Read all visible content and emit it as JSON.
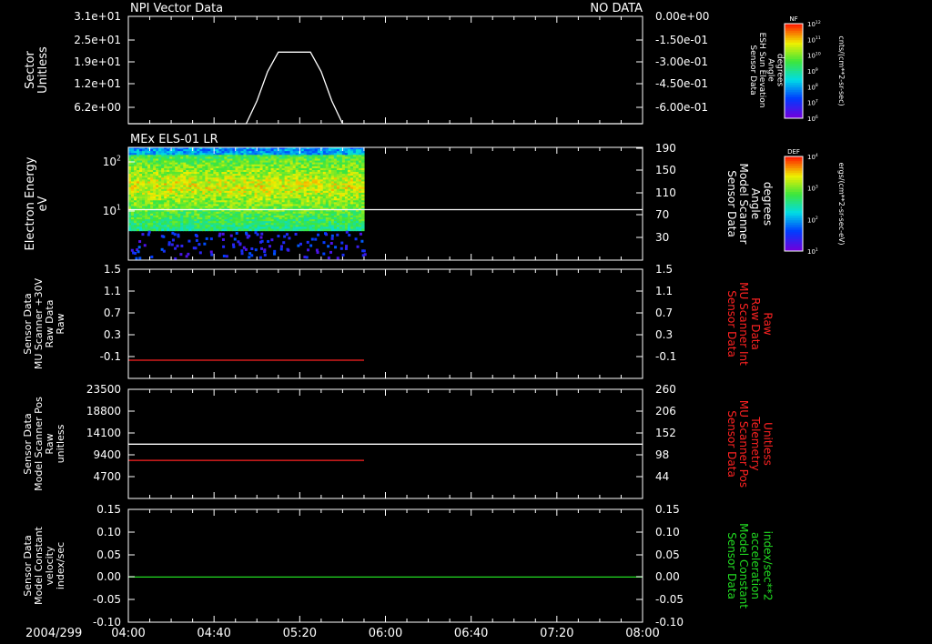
{
  "date_label": "2004/299",
  "time_axis": {
    "range": [
      "04:00",
      "08:00"
    ],
    "ticks": [
      "04:00",
      "04:40",
      "05:20",
      "06:00",
      "06:40",
      "07:20",
      "08:00"
    ]
  },
  "chart_data": [
    {
      "type": "line",
      "title": "NPI Vector Data",
      "status": "NO DATA",
      "ylabel": [
        "Sector",
        "Unitless"
      ],
      "y_ticks": [
        "3.1e+01",
        "2.5e+01",
        "1.9e+01",
        "1.2e+01",
        "6.2e+00"
      ],
      "ylim": [
        0,
        33
      ],
      "right_ylabel": [
        "Sensor Data",
        "ESH Sun Elevation",
        "Angle",
        "degrees"
      ],
      "right_ticks": [
        "0.00e+00",
        "-1.50e-01",
        "-3.00e-01",
        "-4.50e-01",
        "-6.00e-01"
      ],
      "series": [
        {
          "color": "#ffffff",
          "x": [
            "04:00",
            "04:55",
            "05:00",
            "05:05",
            "05:10",
            "05:25",
            "05:30",
            "05:35",
            "05:40",
            "08:00"
          ],
          "y": [
            0,
            0,
            7,
            16,
            22,
            22,
            16,
            7,
            0,
            0
          ]
        }
      ],
      "colorbar": {
        "label": "NF",
        "units": "cnts/(cm**2-sr-sec)",
        "ticks": [
          "10^12",
          "10^11",
          "10^10",
          "10^9",
          "10^8",
          "10^7",
          "10^6"
        ]
      }
    },
    {
      "type": "heatmap",
      "title": "MEx ELS-01 LR",
      "ylabel": [
        "Electron Energy",
        "eV"
      ],
      "y_ticks": [
        "10^2",
        "10^1"
      ],
      "yscale": "log",
      "ylim": [
        1,
        200
      ],
      "right_ylabel": [
        "Sensor Data",
        "Model Scanner",
        "Angle",
        "degrees"
      ],
      "right_ticks": [
        "190",
        "150",
        "110",
        "70",
        "30"
      ],
      "data_extent": [
        "04:00",
        "05:50"
      ],
      "energy_extent": [
        2,
        200
      ],
      "series": [
        {
          "color": "#ffffff",
          "x": [
            "04:00",
            "08:00"
          ],
          "y": [
            90,
            90
          ]
        }
      ],
      "colorbar": {
        "label": "DEF",
        "units": "ergs/(cm**2-sr-sec-eV)",
        "ticks": [
          "10^4",
          "10^3",
          "10^2",
          "10^1"
        ]
      }
    },
    {
      "type": "line",
      "ylabel": [
        "Sensor Data",
        "MU Scanner +30V",
        "Raw Data",
        "Raw"
      ],
      "y_ticks": [
        "1.5",
        "1.1",
        "0.7",
        "0.3",
        "-0.1"
      ],
      "ylim": [
        -0.3,
        1.5
      ],
      "right_ylabel": [
        "Sensor Data",
        "MU Scanner Int",
        "Raw Data",
        "Raw"
      ],
      "right_ticks": [
        "1.5",
        "1.1",
        "0.7",
        "0.3",
        "-0.1"
      ],
      "series": [
        {
          "color": "#ff2222",
          "x": [
            "04:00",
            "05:50"
          ],
          "y": [
            0,
            0
          ]
        }
      ]
    },
    {
      "type": "line",
      "ylabel": [
        "Sensor Data",
        "Model Scanner Pos",
        "Raw",
        "unitless"
      ],
      "y_ticks": [
        "23500",
        "18800",
        "14100",
        "9400",
        "4700"
      ],
      "ylim": [
        0,
        23500
      ],
      "right_ylabel": [
        "Sensor Data",
        "MU Scanner Pos",
        "Telemetry",
        "Unitless"
      ],
      "right_ticks": [
        "260",
        "206",
        "152",
        "98",
        "44"
      ],
      "series": [
        {
          "color": "#ffffff",
          "x": [
            "04:00",
            "08:00"
          ],
          "y": [
            11700,
            11700
          ]
        },
        {
          "color": "#ff2222",
          "x": [
            "04:00",
            "05:50"
          ],
          "y": [
            8200,
            8200
          ]
        }
      ]
    },
    {
      "type": "line",
      "ylabel": [
        "Sensor Data",
        "Model Constant",
        "velocity",
        "index/sec"
      ],
      "y_ticks": [
        "0.15",
        "0.10",
        "0.05",
        "0.00",
        "-0.05",
        "-0.10"
      ],
      "ylim": [
        -0.1,
        0.15
      ],
      "right_ylabel": [
        "Sensor Data",
        "Model Constant",
        "acceleration",
        "index/sec**2"
      ],
      "right_ticks": [
        "0.15",
        "0.10",
        "0.05",
        "0.00",
        "-0.05",
        "-0.10"
      ],
      "series": [
        {
          "color": "#22dd22",
          "x": [
            "04:00",
            "08:00"
          ],
          "y": [
            0,
            0
          ]
        }
      ]
    }
  ]
}
